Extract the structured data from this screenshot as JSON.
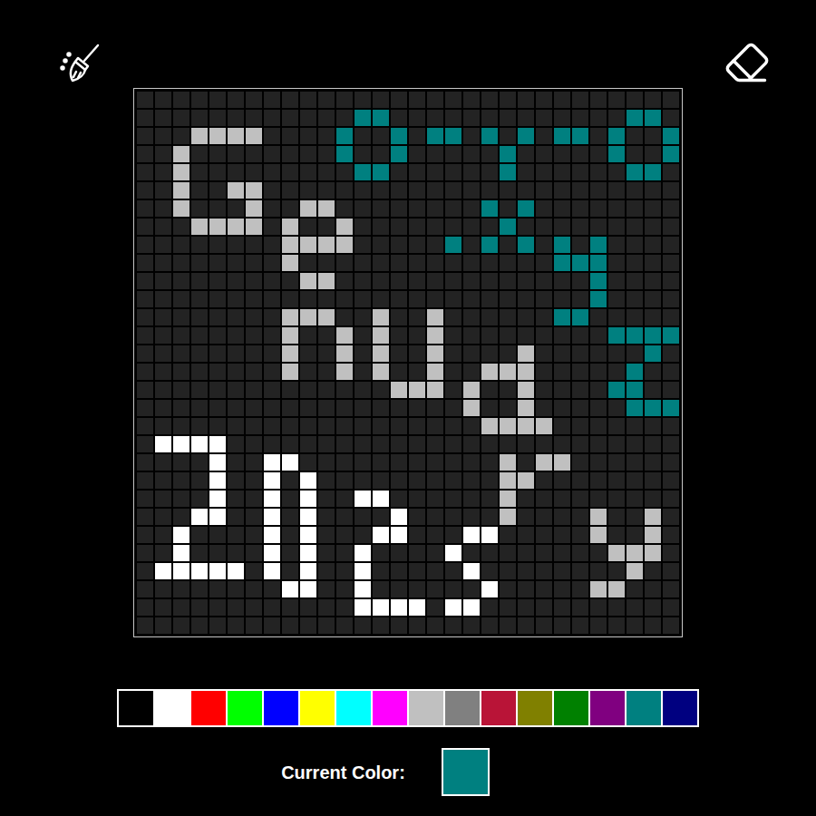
{
  "canvas": {
    "ink": {
      "1": "#ffffff",
      "2": "#c0c0c0",
      "3": "#008080"
    },
    "rows": [
      [
        0,
        0,
        0,
        0,
        0,
        0,
        0,
        0,
        0,
        0,
        0,
        0,
        0,
        0,
        0,
        0,
        0,
        0,
        0,
        0,
        0,
        0,
        0,
        0,
        0,
        0,
        0,
        0,
        0,
        0
      ],
      [
        0,
        0,
        0,
        0,
        0,
        0,
        0,
        0,
        0,
        0,
        0,
        0,
        3,
        3,
        0,
        0,
        0,
        0,
        0,
        0,
        0,
        0,
        0,
        0,
        0,
        0,
        0,
        3,
        3,
        0
      ],
      [
        0,
        0,
        0,
        2,
        2,
        2,
        2,
        0,
        0,
        0,
        0,
        3,
        0,
        0,
        3,
        0,
        3,
        3,
        0,
        3,
        0,
        3,
        0,
        3,
        3,
        0,
        3,
        0,
        0,
        3
      ],
      [
        0,
        0,
        2,
        0,
        0,
        0,
        0,
        0,
        0,
        0,
        0,
        3,
        0,
        0,
        3,
        0,
        0,
        0,
        0,
        0,
        3,
        0,
        0,
        0,
        0,
        0,
        3,
        0,
        0,
        3
      ],
      [
        0,
        0,
        2,
        0,
        0,
        0,
        0,
        0,
        0,
        0,
        0,
        0,
        3,
        3,
        0,
        0,
        0,
        0,
        0,
        0,
        3,
        0,
        0,
        0,
        0,
        0,
        0,
        3,
        3,
        0
      ],
      [
        0,
        0,
        2,
        0,
        0,
        2,
        2,
        0,
        0,
        0,
        0,
        0,
        0,
        0,
        0,
        0,
        0,
        0,
        0,
        0,
        0,
        0,
        0,
        0,
        0,
        0,
        0,
        0,
        0,
        0
      ],
      [
        0,
        0,
        2,
        0,
        0,
        0,
        2,
        0,
        0,
        2,
        2,
        0,
        0,
        0,
        0,
        0,
        0,
        0,
        0,
        3,
        0,
        3,
        0,
        0,
        0,
        0,
        0,
        0,
        0,
        0
      ],
      [
        0,
        0,
        0,
        2,
        2,
        2,
        2,
        0,
        2,
        0,
        0,
        2,
        0,
        0,
        0,
        0,
        0,
        0,
        0,
        0,
        3,
        0,
        0,
        0,
        0,
        0,
        0,
        0,
        0,
        0
      ],
      [
        0,
        0,
        0,
        0,
        0,
        0,
        0,
        0,
        2,
        2,
        2,
        2,
        0,
        0,
        0,
        0,
        0,
        3,
        0,
        3,
        0,
        3,
        0,
        3,
        0,
        3,
        0,
        0,
        0,
        0
      ],
      [
        0,
        0,
        0,
        0,
        0,
        0,
        0,
        0,
        2,
        0,
        0,
        0,
        0,
        0,
        0,
        0,
        0,
        0,
        0,
        0,
        0,
        0,
        0,
        3,
        3,
        3,
        0,
        0,
        0,
        0
      ],
      [
        0,
        0,
        0,
        0,
        0,
        0,
        0,
        0,
        0,
        2,
        2,
        0,
        0,
        0,
        0,
        0,
        0,
        0,
        0,
        0,
        0,
        0,
        0,
        0,
        0,
        3,
        0,
        0,
        0,
        0
      ],
      [
        0,
        0,
        0,
        0,
        0,
        0,
        0,
        0,
        0,
        0,
        0,
        0,
        0,
        0,
        0,
        0,
        0,
        0,
        0,
        0,
        0,
        0,
        0,
        0,
        0,
        3,
        0,
        0,
        0,
        0
      ],
      [
        0,
        0,
        0,
        0,
        0,
        0,
        0,
        0,
        2,
        2,
        2,
        0,
        0,
        2,
        0,
        0,
        2,
        0,
        0,
        0,
        0,
        0,
        0,
        3,
        3,
        0,
        0,
        0,
        0,
        0
      ],
      [
        0,
        0,
        0,
        0,
        0,
        0,
        0,
        0,
        2,
        0,
        0,
        2,
        0,
        2,
        0,
        0,
        2,
        0,
        0,
        0,
        0,
        0,
        0,
        0,
        0,
        0,
        3,
        3,
        3,
        3
      ],
      [
        0,
        0,
        0,
        0,
        0,
        0,
        0,
        0,
        2,
        0,
        0,
        2,
        0,
        2,
        0,
        0,
        2,
        0,
        0,
        0,
        0,
        2,
        0,
        0,
        0,
        0,
        0,
        0,
        3,
        0
      ],
      [
        0,
        0,
        0,
        0,
        0,
        0,
        0,
        0,
        2,
        0,
        0,
        2,
        0,
        2,
        0,
        0,
        2,
        0,
        0,
        2,
        2,
        2,
        0,
        0,
        0,
        0,
        0,
        3,
        0,
        0
      ],
      [
        0,
        0,
        0,
        0,
        0,
        0,
        0,
        0,
        0,
        0,
        0,
        0,
        0,
        0,
        2,
        2,
        2,
        0,
        2,
        0,
        0,
        2,
        0,
        0,
        0,
        0,
        3,
        3,
        0,
        0
      ],
      [
        0,
        0,
        0,
        0,
        0,
        0,
        0,
        0,
        0,
        0,
        0,
        0,
        0,
        0,
        0,
        0,
        0,
        0,
        2,
        0,
        0,
        2,
        0,
        0,
        0,
        0,
        0,
        3,
        3,
        3
      ],
      [
        0,
        0,
        0,
        0,
        0,
        0,
        0,
        0,
        0,
        0,
        0,
        0,
        0,
        0,
        0,
        0,
        0,
        0,
        0,
        2,
        2,
        2,
        2,
        0,
        0,
        0,
        0,
        0,
        0,
        0
      ],
      [
        0,
        1,
        1,
        1,
        1,
        0,
        0,
        0,
        0,
        0,
        0,
        0,
        0,
        0,
        0,
        0,
        0,
        0,
        0,
        0,
        0,
        0,
        0,
        0,
        0,
        0,
        0,
        0,
        0,
        0
      ],
      [
        0,
        0,
        0,
        0,
        1,
        0,
        0,
        1,
        1,
        0,
        0,
        0,
        0,
        0,
        0,
        0,
        0,
        0,
        0,
        0,
        2,
        0,
        2,
        2,
        0,
        0,
        0,
        0,
        0,
        0
      ],
      [
        0,
        0,
        0,
        0,
        1,
        0,
        0,
        1,
        0,
        1,
        0,
        0,
        0,
        0,
        0,
        0,
        0,
        0,
        0,
        0,
        2,
        2,
        0,
        0,
        0,
        0,
        0,
        0,
        0,
        0
      ],
      [
        0,
        0,
        0,
        0,
        1,
        0,
        0,
        1,
        0,
        1,
        0,
        0,
        1,
        1,
        0,
        0,
        0,
        0,
        0,
        0,
        2,
        0,
        0,
        0,
        0,
        0,
        0,
        0,
        0,
        0
      ],
      [
        0,
        0,
        0,
        1,
        1,
        0,
        0,
        1,
        0,
        1,
        0,
        0,
        0,
        0,
        1,
        0,
        0,
        0,
        0,
        0,
        2,
        0,
        0,
        0,
        0,
        2,
        0,
        0,
        2,
        0
      ],
      [
        0,
        0,
        1,
        0,
        0,
        0,
        0,
        1,
        0,
        1,
        0,
        0,
        0,
        1,
        1,
        0,
        0,
        0,
        1,
        1,
        0,
        0,
        0,
        0,
        0,
        2,
        0,
        0,
        2,
        0
      ],
      [
        0,
        0,
        1,
        0,
        0,
        0,
        0,
        1,
        0,
        1,
        0,
        0,
        1,
        0,
        0,
        0,
        0,
        1,
        0,
        0,
        0,
        0,
        0,
        0,
        0,
        0,
        2,
        2,
        2,
        0
      ],
      [
        0,
        1,
        1,
        1,
        1,
        1,
        0,
        1,
        0,
        1,
        0,
        0,
        1,
        0,
        0,
        0,
        0,
        0,
        1,
        0,
        0,
        0,
        0,
        0,
        0,
        0,
        0,
        2,
        0,
        0
      ],
      [
        0,
        0,
        0,
        0,
        0,
        0,
        0,
        0,
        1,
        1,
        0,
        0,
        1,
        0,
        0,
        0,
        0,
        0,
        0,
        1,
        0,
        0,
        0,
        0,
        0,
        2,
        2,
        0,
        0,
        0
      ],
      [
        0,
        0,
        0,
        0,
        0,
        0,
        0,
        0,
        0,
        0,
        0,
        0,
        1,
        1,
        1,
        1,
        0,
        1,
        1,
        0,
        0,
        0,
        0,
        0,
        0,
        0,
        0,
        0,
        0,
        0
      ],
      [
        0,
        0,
        0,
        0,
        0,
        0,
        0,
        0,
        0,
        0,
        0,
        0,
        0,
        0,
        0,
        0,
        0,
        0,
        0,
        0,
        0,
        0,
        0,
        0,
        0,
        0,
        0,
        0,
        0,
        0
      ]
    ]
  },
  "palette": [
    {
      "color": "#000000"
    },
    {
      "color": "#ffffff"
    },
    {
      "color": "#ff0000"
    },
    {
      "color": "#00ff00"
    },
    {
      "color": "#0000ff"
    },
    {
      "color": "#ffff00"
    },
    {
      "color": "#00ffff"
    },
    {
      "color": "#ff00ff"
    },
    {
      "color": "#c0c0c0"
    },
    {
      "color": "#808080"
    },
    {
      "color": "#b91437"
    },
    {
      "color": "#808000"
    },
    {
      "color": "#008000"
    },
    {
      "color": "#800080"
    },
    {
      "color": "#008080"
    },
    {
      "color": "#000080"
    }
  ],
  "current_color": {
    "label": "Current Color:",
    "color": "#008080"
  }
}
